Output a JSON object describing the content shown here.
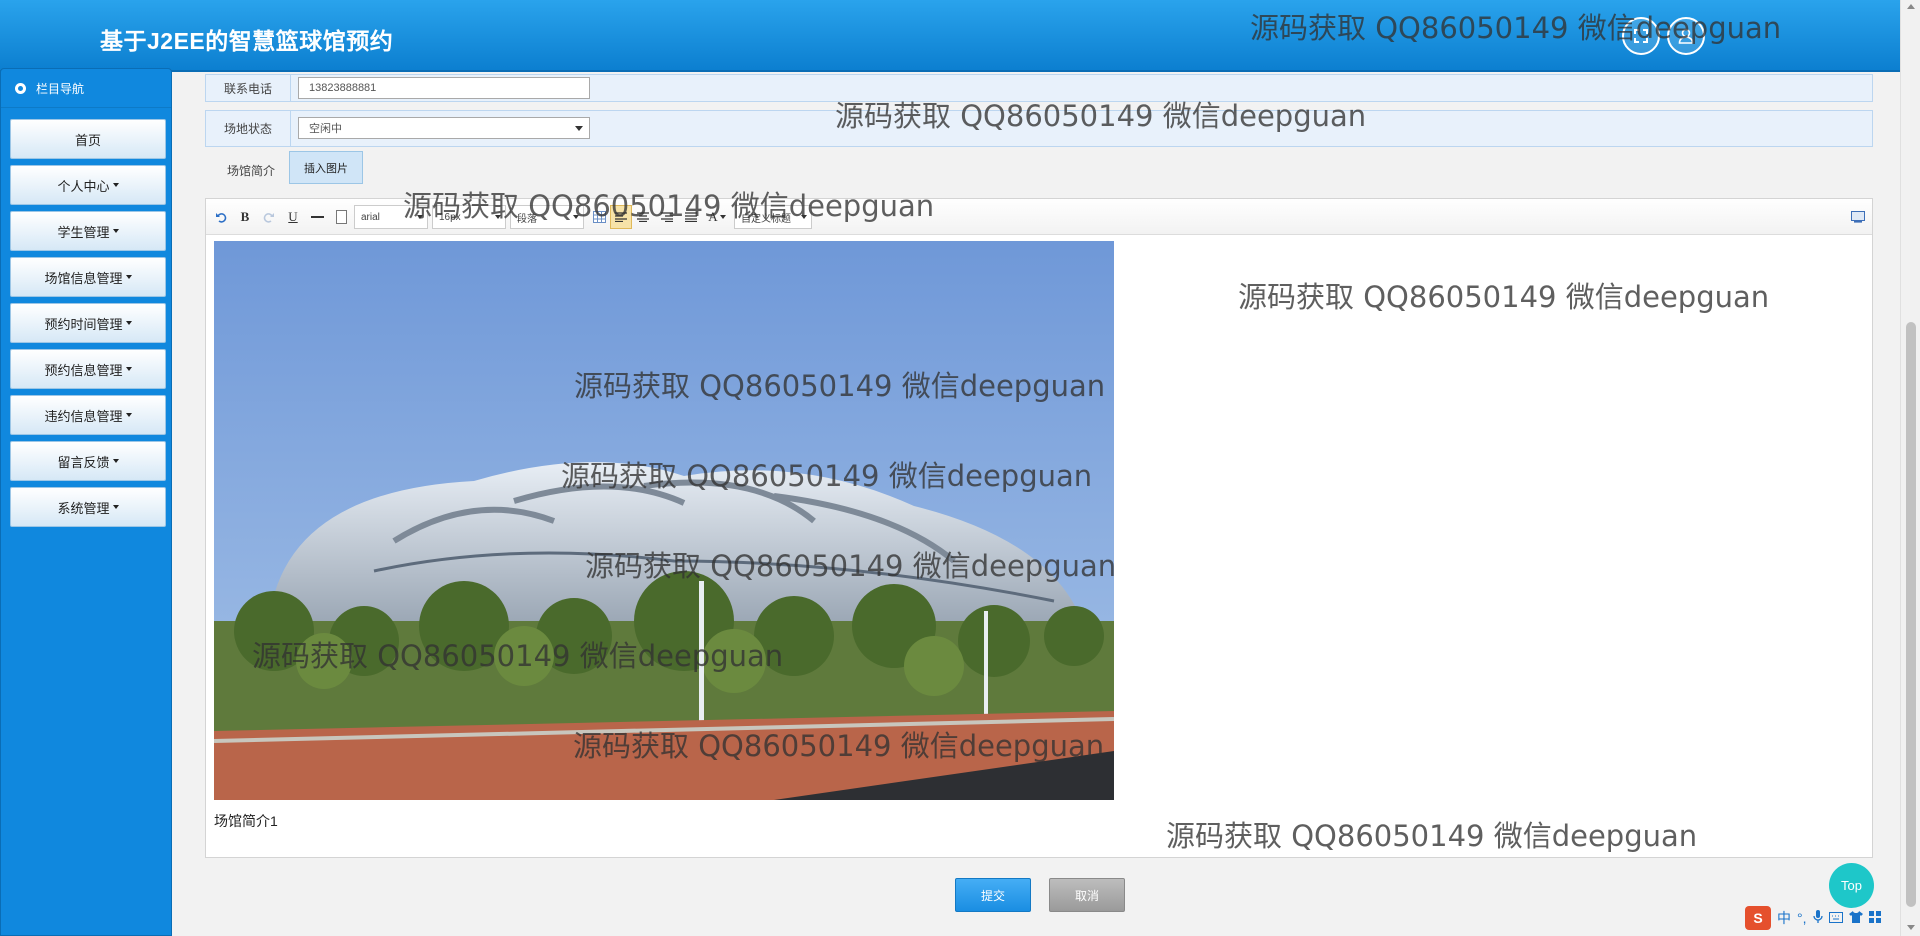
{
  "header": {
    "title": "基于J2EE的智慧篮球馆预约"
  },
  "sidebar": {
    "heading": "栏目导航",
    "items": [
      {
        "label": "首页",
        "has_dropdown": false
      },
      {
        "label": "个人中心",
        "has_dropdown": true
      },
      {
        "label": "学生管理",
        "has_dropdown": true
      },
      {
        "label": "场馆信息管理",
        "has_dropdown": true
      },
      {
        "label": "预约时间管理",
        "has_dropdown": true
      },
      {
        "label": "预约信息管理",
        "has_dropdown": true
      },
      {
        "label": "违约信息管理",
        "has_dropdown": true
      },
      {
        "label": "留言反馈",
        "has_dropdown": true
      },
      {
        "label": "系统管理",
        "has_dropdown": true
      }
    ]
  },
  "form": {
    "phone": {
      "label": "联系电话",
      "value": "13823888881"
    },
    "status": {
      "label": "场地状态",
      "value": "空闲中"
    },
    "intro": {
      "label": "场馆简介",
      "insert_image_label": "插入图片"
    }
  },
  "editor": {
    "toolbar": {
      "font": "arial",
      "size": "16px",
      "paragraph": "段落",
      "custom_title": "自定义标题"
    },
    "caption": "场馆简介1",
    "image_icon": "stadium-photo"
  },
  "actions": {
    "submit_label": "提交",
    "cancel_label": "取消"
  },
  "floating": {
    "top_label": "Top"
  },
  "watermark": "源码获取 QQ86050149 微信deepguan",
  "tray": {
    "ime": "中"
  },
  "colors": {
    "header": "#1b8fe0",
    "sidebar": "#1088de",
    "submit": "#2d9ef0",
    "cancel": "#a9a9a9"
  }
}
